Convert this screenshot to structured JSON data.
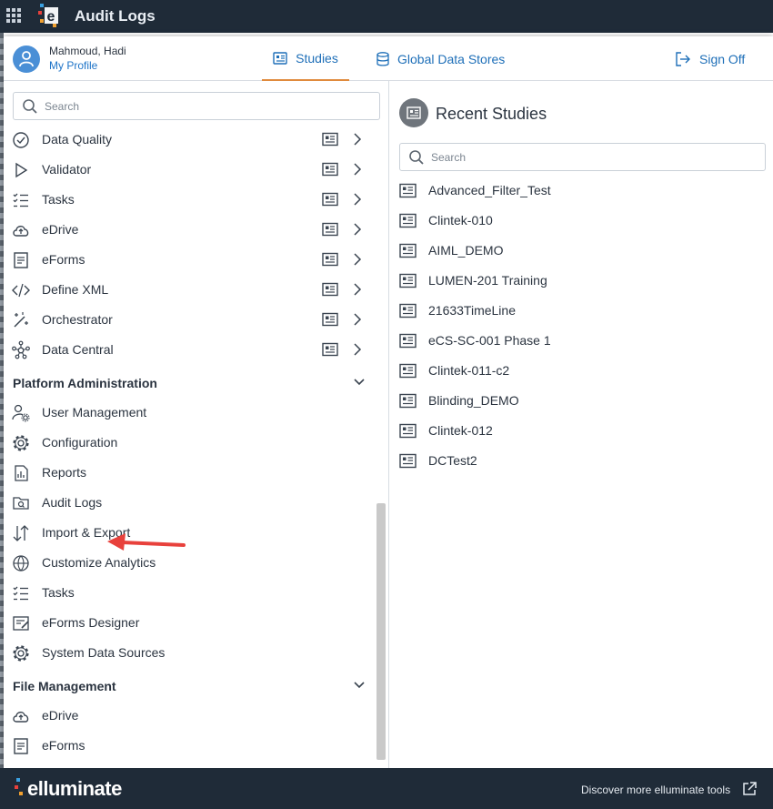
{
  "app": {
    "title": "Audit Logs"
  },
  "user": {
    "name": "Mahmoud, Hadi",
    "profile_link": "My Profile"
  },
  "tabs": [
    {
      "label": "Studies",
      "active": true
    },
    {
      "label": "Global Data Stores",
      "active": false
    },
    {
      "label": "Sign Off",
      "active": false
    }
  ],
  "left_search": {
    "placeholder": "Search"
  },
  "study_tools": [
    {
      "label": "Data Quality",
      "icon": "check-circle-icon"
    },
    {
      "label": "Validator",
      "icon": "play-outline-icon"
    },
    {
      "label": "Tasks",
      "icon": "checklist-icon"
    },
    {
      "label": "eDrive",
      "icon": "cloud-upload-icon"
    },
    {
      "label": "eForms",
      "icon": "form-icon"
    },
    {
      "label": "Define XML",
      "icon": "code-icon"
    },
    {
      "label": "Orchestrator",
      "icon": "magic-wand-icon"
    },
    {
      "label": "Data Central",
      "icon": "network-icon"
    }
  ],
  "platform_admin": {
    "title": "Platform Administration",
    "items": [
      {
        "label": "User Management",
        "icon": "user-gear-icon"
      },
      {
        "label": "Configuration",
        "icon": "gear-icon"
      },
      {
        "label": "Reports",
        "icon": "report-icon"
      },
      {
        "label": "Audit Logs",
        "icon": "folder-search-icon"
      },
      {
        "label": "Import & Export",
        "icon": "import-export-icon"
      },
      {
        "label": "Customize Analytics",
        "icon": "analytics-icon"
      },
      {
        "label": "Tasks",
        "icon": "checklist-icon"
      },
      {
        "label": "eForms Designer",
        "icon": "form-edit-icon"
      },
      {
        "label": "System Data Sources",
        "icon": "gear-icon"
      }
    ]
  },
  "file_management": {
    "title": "File Management",
    "items": [
      {
        "label": "eDrive",
        "icon": "cloud-upload-icon"
      },
      {
        "label": "eForms",
        "icon": "form-icon"
      }
    ]
  },
  "recent_studies": {
    "title": "Recent Studies",
    "search_placeholder": "Search",
    "items": [
      "Advanced_Filter_Test",
      "Clintek-010",
      "AIML_DEMO",
      "LUMEN-201 Training",
      "21633TimeLine",
      "eCS-SC-001 Phase 1",
      "Clintek-011-c2",
      "Blinding_DEMO",
      "Clintek-012",
      "DCTest2"
    ]
  },
  "footer": {
    "logo_text": "elluminate",
    "link": "Discover more elluminate tools"
  },
  "colors": {
    "topbar": "#1f2b38",
    "accent_tab": "#e08a3c",
    "link_blue": "#1e6fb8",
    "annotation_arrow": "#e8413c"
  }
}
